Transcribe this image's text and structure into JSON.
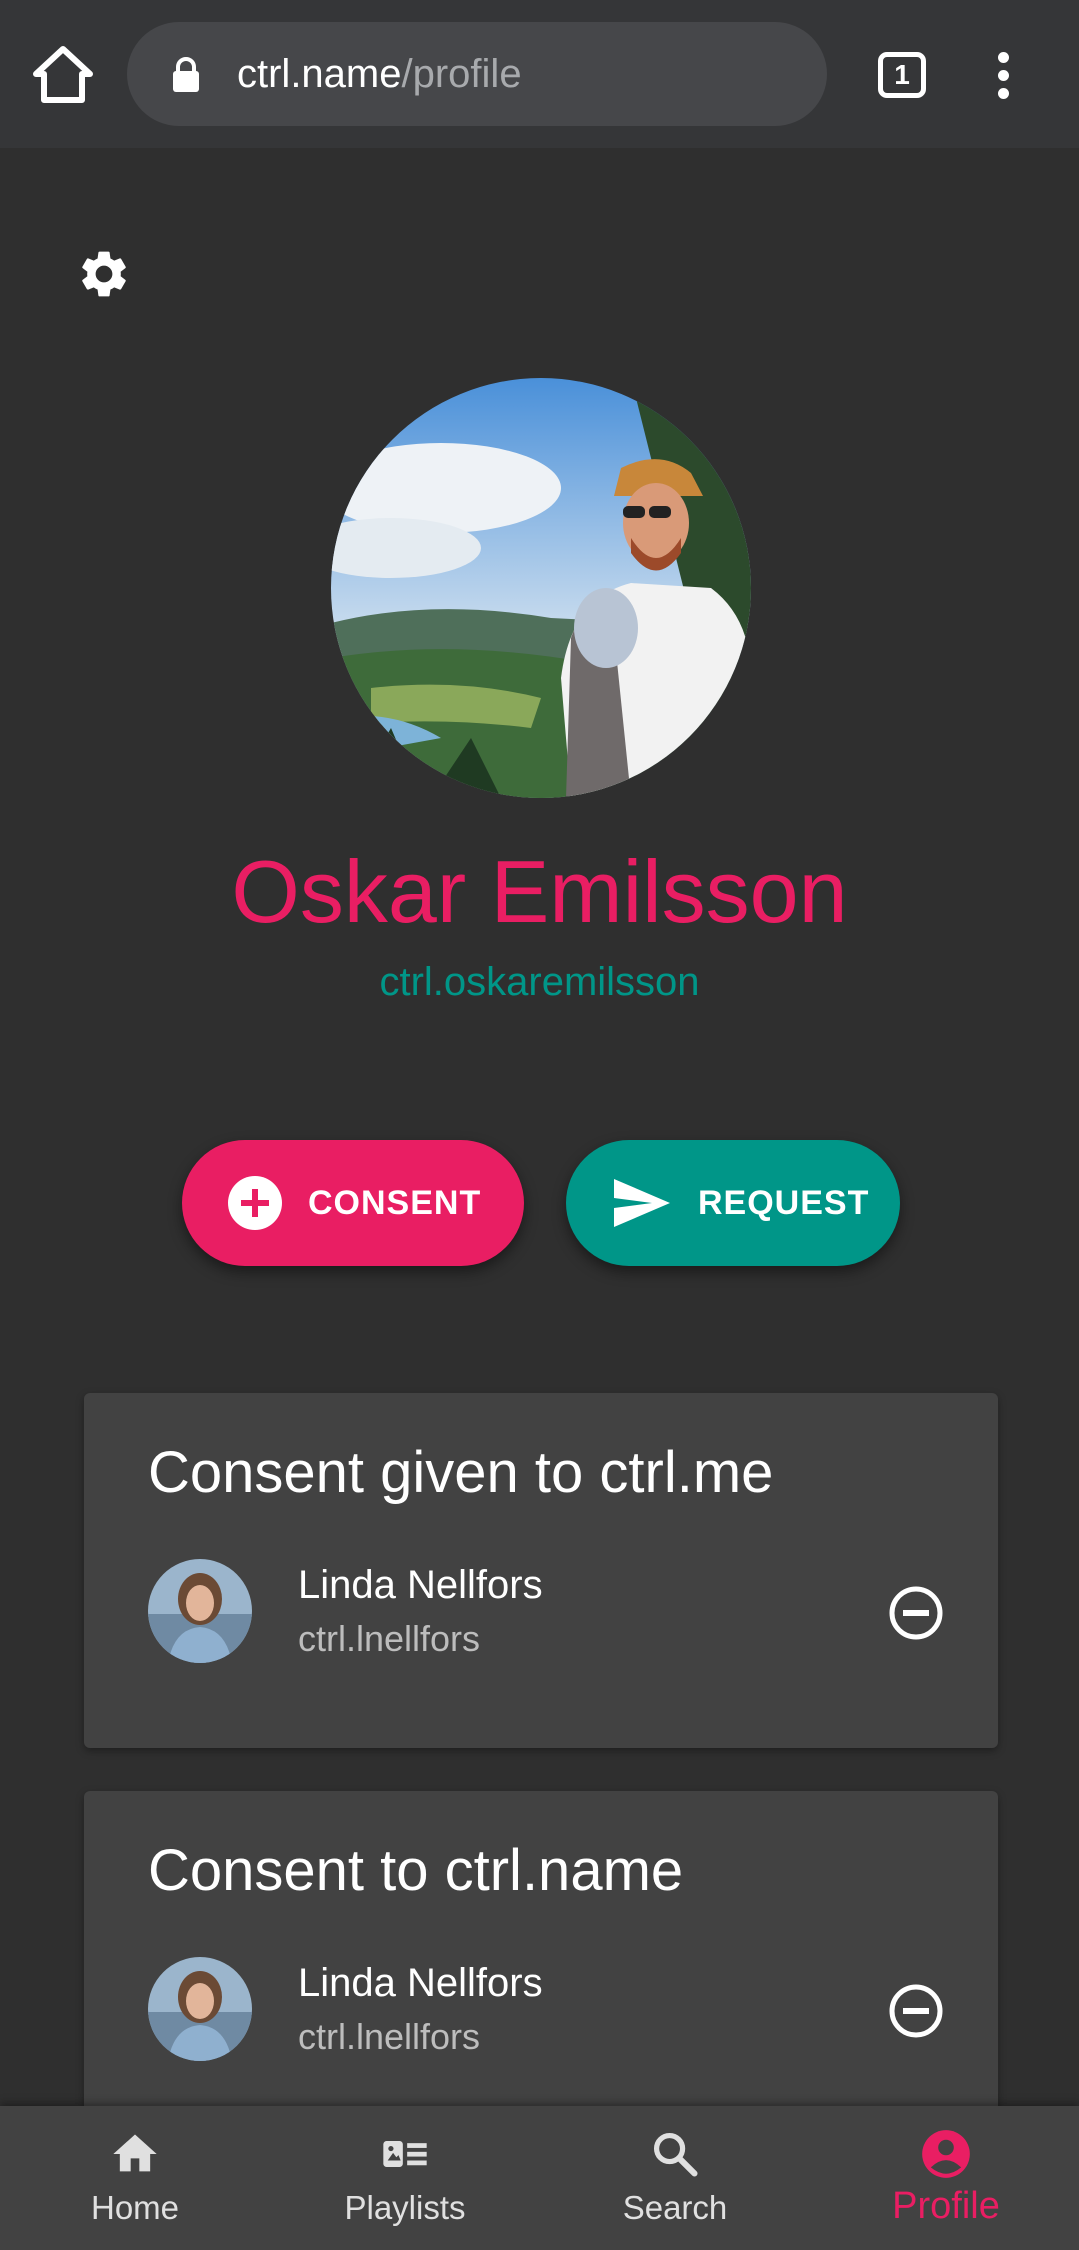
{
  "browser": {
    "url_host": "ctrl.name",
    "url_path": "/profile",
    "tab_count": "1",
    "icons": [
      "home-icon",
      "lock-icon",
      "tabs-icon",
      "more-vert-icon"
    ]
  },
  "profile": {
    "name": "Oskar Emilsson",
    "handle": "ctrl.oskaremilsson",
    "name_color": "#e91e63",
    "handle_color": "#009688"
  },
  "actions": {
    "consent_label": "CONSENT",
    "request_label": "REQUEST",
    "consent_color": "#e91e63",
    "request_color": "#009688"
  },
  "cards": [
    {
      "title": "Consent given to ctrl.me",
      "person": {
        "name": "Linda Nellfors",
        "handle": "ctrl.lnellfors"
      }
    },
    {
      "title": "Consent to ctrl.name",
      "person": {
        "name": "Linda Nellfors",
        "handle": "ctrl.lnellfors"
      }
    }
  ],
  "nav": {
    "items": [
      {
        "label": "Home",
        "icon": "home-icon"
      },
      {
        "label": "Playlists",
        "icon": "playlists-icon"
      },
      {
        "label": "Search",
        "icon": "search-icon"
      },
      {
        "label": "Profile",
        "icon": "account-circle-icon",
        "active": true
      }
    ],
    "active_color": "#e91e63"
  }
}
